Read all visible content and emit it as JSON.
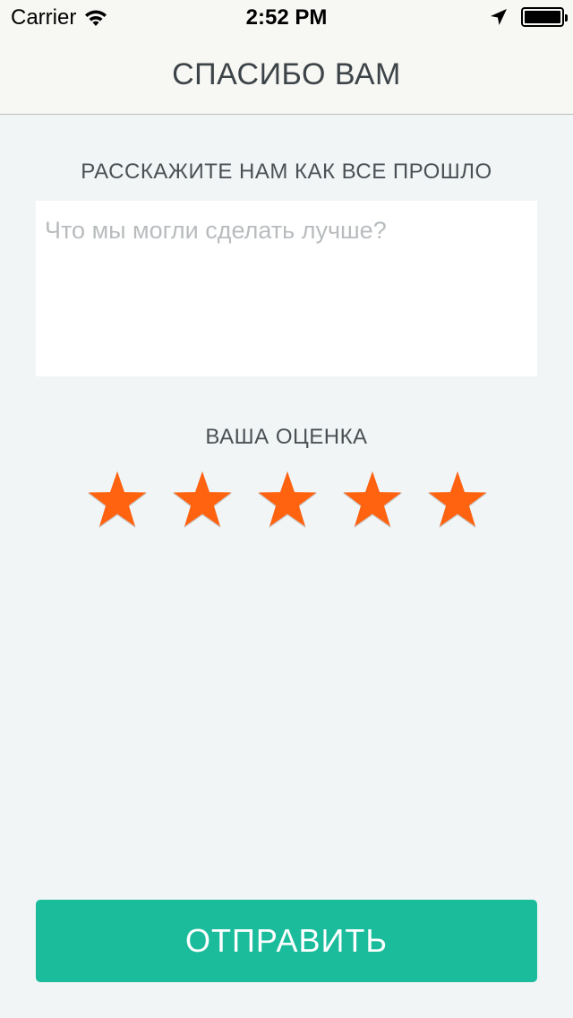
{
  "status_bar": {
    "carrier": "Carrier",
    "time": "2:52 PM",
    "battery_level": 1.0
  },
  "nav": {
    "title": "СПАСИБО ВАМ"
  },
  "feedback": {
    "label": "РАССКАЖИТЕ НАМ КАК ВСЕ ПРОШЛО",
    "placeholder": "Что мы могли сделать лучше?",
    "value": ""
  },
  "rating": {
    "label": "ВАША ОЦЕНКА",
    "value": 5,
    "max": 5,
    "star_color": "#ff6310"
  },
  "submit": {
    "label": "ОТПРАВИТЬ",
    "color": "#1abc9c"
  },
  "icons": {
    "wifi": "wifi-icon",
    "location": "location-arrow-icon",
    "battery": "battery-icon",
    "star": "star-icon"
  }
}
